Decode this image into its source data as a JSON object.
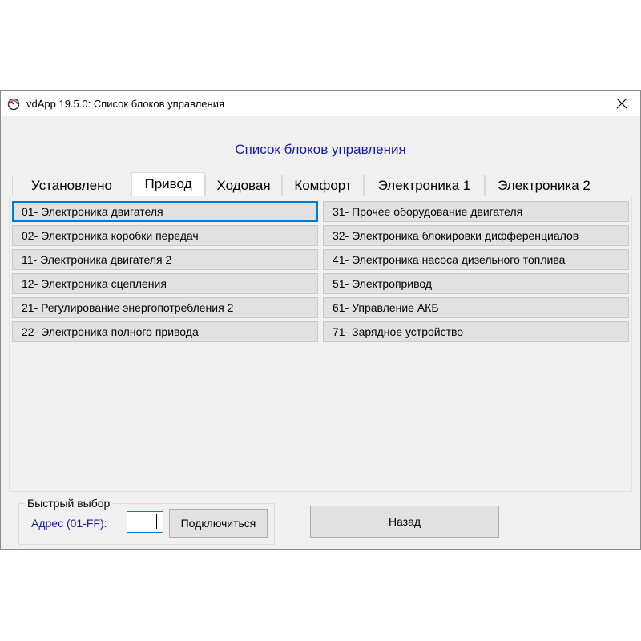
{
  "window": {
    "title": "vdApp 19.5.0:  Список блоков управления",
    "close_glyph": "✕",
    "app_icon": "speedometer-icon"
  },
  "heading": "Список блоков управления",
  "tabs": [
    {
      "label": "Установлено",
      "active": false
    },
    {
      "label": "Привод",
      "active": true
    },
    {
      "label": "Ходовая",
      "active": false
    },
    {
      "label": "Комфорт",
      "active": false
    },
    {
      "label": "Электроника 1",
      "active": false
    },
    {
      "label": "Электроника 2",
      "active": false
    }
  ],
  "units_left": [
    "01- Электроника двигателя",
    "02- Электроника коробки передач",
    "11- Электроника двигателя 2",
    "12- Электроника сцепления",
    "21- Регулирование энергопотребления 2",
    "22- Электроника полного привода"
  ],
  "units_right": [
    "31- Прочее оборудование двигателя",
    "32- Электроника блокировки дифференциалов",
    "41- Электроника насоса дизельного топлива",
    "51- Электропривод",
    "61- Управление АКБ",
    "71- Зарядное устройство"
  ],
  "quick_select": {
    "legend": "Быстрый выбор",
    "address_label": "Адрес (01-FF):",
    "address_value": "",
    "connect_label": "Подключиться"
  },
  "back_label": "Назад",
  "colors": {
    "accent": "#0078d7",
    "heading": "#1a1aa6",
    "window_bg": "#f0f0f0",
    "button_bg": "#e1e1e1"
  }
}
